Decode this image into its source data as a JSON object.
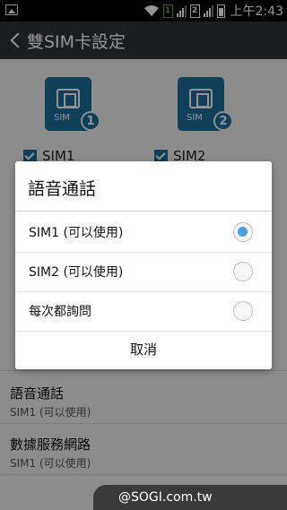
{
  "status_bar": {
    "sim1_badge": "1",
    "sim2_badge": "2",
    "time": "上午2:43"
  },
  "app_bar": {
    "title": "雙SIM卡設定"
  },
  "sim_cards": [
    {
      "card_label": "SIM",
      "number": "1",
      "checkbox_label": "SIM1"
    },
    {
      "card_label": "SIM",
      "number": "2",
      "checkbox_label": "SIM2"
    }
  ],
  "settings": [
    {
      "title": "語音通話",
      "subtitle": "SIM1 (可以使用)"
    },
    {
      "title": "數據服務網路",
      "subtitle": "SIM1 (可以使用)"
    }
  ],
  "dialog": {
    "title": "語音通話",
    "options": [
      {
        "label": "SIM1 (可以使用)",
        "selected": true
      },
      {
        "label": "SIM2 (可以使用)",
        "selected": false
      },
      {
        "label": "每次都詢問",
        "selected": false
      }
    ],
    "cancel_label": "取消"
  },
  "watermark": "@SOGI.com.tw",
  "colors": {
    "accent": "#1b6d9a",
    "radio_selected": "#4aa3df",
    "app_bar": "#2f3235"
  }
}
